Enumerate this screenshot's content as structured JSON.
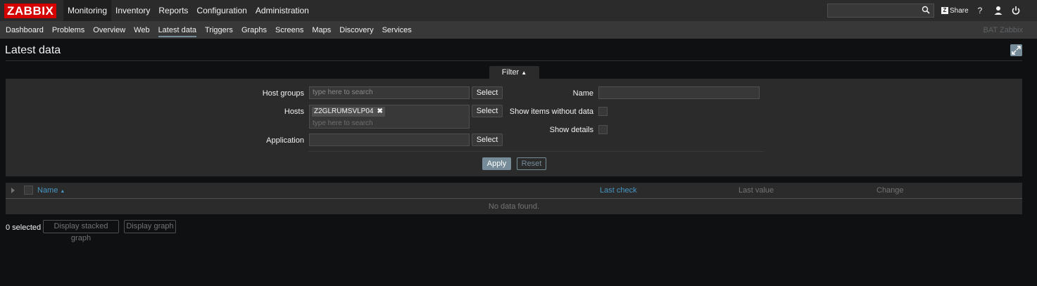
{
  "logo": "ZABBIX",
  "main_menu": [
    "Monitoring",
    "Inventory",
    "Reports",
    "Configuration",
    "Administration"
  ],
  "top_right": {
    "share_label": "Share",
    "help_icon": "?",
    "icons": [
      "search-icon",
      "share-icon",
      "help-icon",
      "user-icon",
      "power-icon"
    ]
  },
  "sub_menu": [
    "Dashboard",
    "Problems",
    "Overview",
    "Web",
    "Latest data",
    "Triggers",
    "Graphs",
    "Screens",
    "Maps",
    "Discovery",
    "Services"
  ],
  "server_name": "BAT Zabbix",
  "page_title": "Latest data",
  "filter": {
    "tab_label": "Filter",
    "host_groups_label": "Host groups",
    "host_groups_placeholder": "type here to search",
    "hosts_label": "Hosts",
    "host_tag": "Z2GLRUMSVLP04",
    "hosts_placeholder": "type here to search",
    "application_label": "Application",
    "application_value": "",
    "select_label": "Select",
    "name_label": "Name",
    "name_value": "",
    "show_without_data_label": "Show items without data",
    "show_details_label": "Show details",
    "apply_label": "Apply",
    "reset_label": "Reset"
  },
  "table": {
    "columns": {
      "name": "Name",
      "last_check": "Last check",
      "last_value": "Last value",
      "change": "Change"
    },
    "empty_text": "No data found."
  },
  "footer": {
    "selected_text": "0 selected",
    "stacked_graph_label": "Display stacked graph",
    "graph_label": "Display graph"
  },
  "colors": {
    "logo_bg": "#d40000",
    "accent": "#768d99",
    "link": "#4796c4",
    "background": "#0e1012"
  }
}
